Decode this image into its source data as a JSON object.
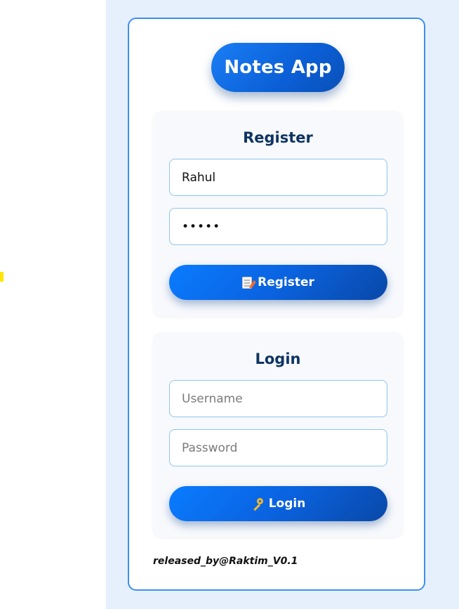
{
  "app": {
    "title": "Notes App"
  },
  "register": {
    "heading": "Register",
    "username_value": "Rahul",
    "password_value": "•••••",
    "button_label": "Register",
    "button_icon": "memo-icon"
  },
  "login": {
    "heading": "Login",
    "username_placeholder": "Username",
    "password_placeholder": "Password",
    "button_label": "Login",
    "button_icon": "key-icon"
  },
  "footer": {
    "credit": "released_by@Raktim_V0.1"
  },
  "colors": {
    "accent": "#0b63e0",
    "card_border": "#3d8ef0",
    "heading": "#0f3460",
    "page_background": "#e6f0fd"
  }
}
